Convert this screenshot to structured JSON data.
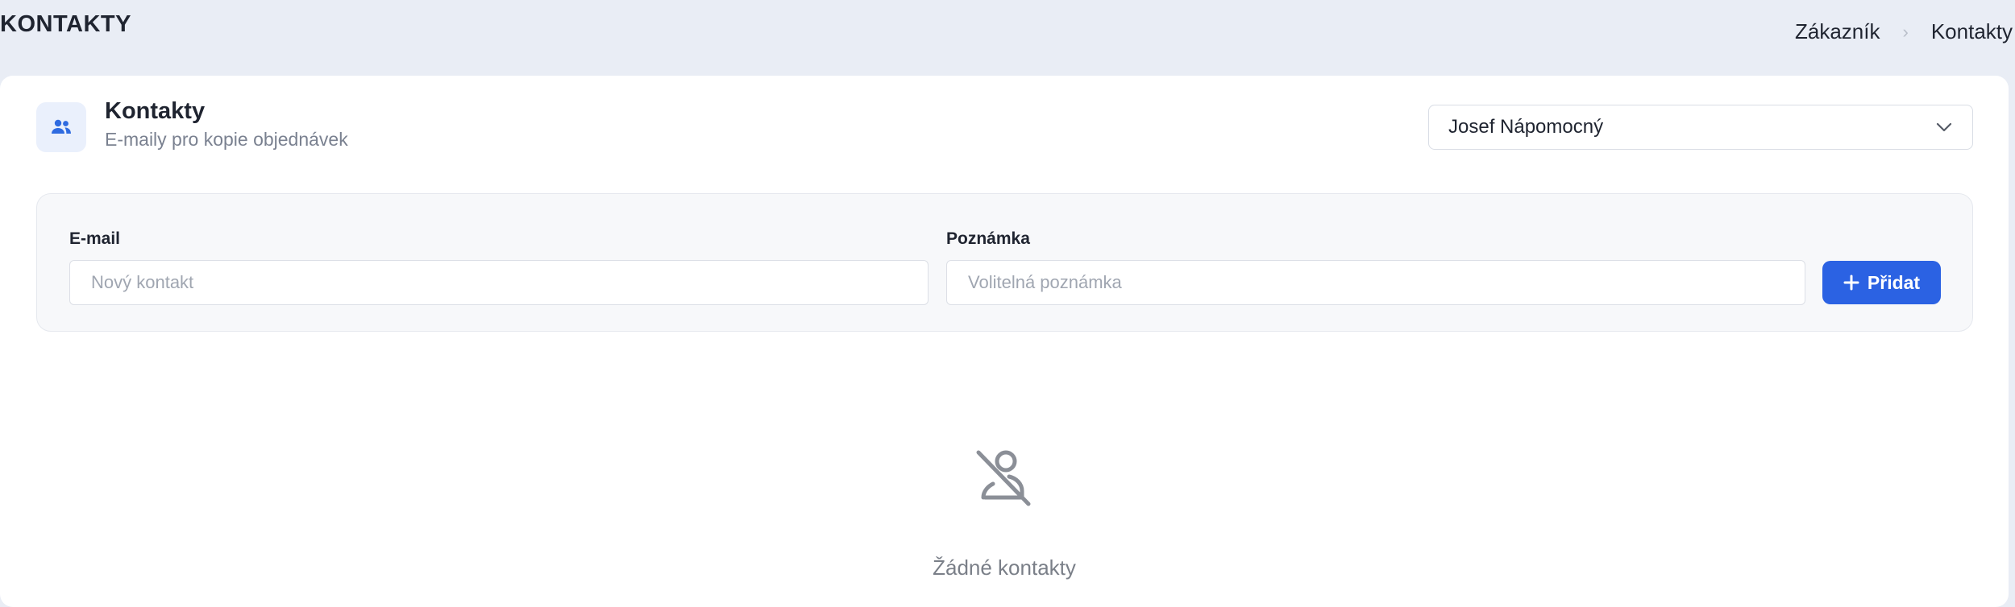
{
  "page": {
    "title": "KONTAKTY"
  },
  "breadcrumb": {
    "items": [
      "Zákazník",
      "Kontakty"
    ],
    "separator_icon": "chevron-right-icon"
  },
  "card": {
    "icon": "users-icon",
    "title": "Kontakty",
    "subtitle": "E-maily pro kopie objednávek",
    "customer_select": {
      "value": "Josef Nápomocný",
      "icon": "chevron-down-icon"
    }
  },
  "form": {
    "email_label": "E-mail",
    "email_placeholder": "Nový kontakt",
    "email_value": "",
    "note_label": "Poznámka",
    "note_placeholder": "Volitelná poznámka",
    "note_value": "",
    "add_button_label": "Přidat",
    "add_button_icon": "plus-icon"
  },
  "empty_state": {
    "icon": "user-off-icon",
    "text": "Žádné kontakty"
  },
  "colors": {
    "background": "#e9edf5",
    "accent": "#2b62e3",
    "icon_tile": "#eaf0fc",
    "muted_text": "#7a8190"
  }
}
